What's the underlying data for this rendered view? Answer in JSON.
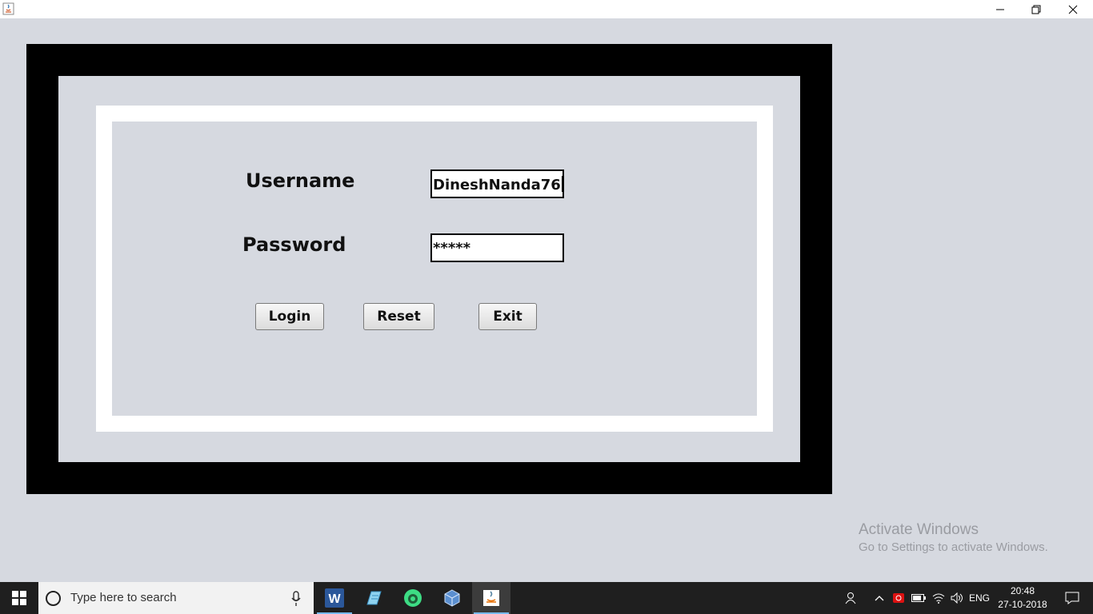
{
  "window": {
    "minimize_icon": "minimize-icon",
    "maximize_icon": "restore-icon",
    "close_icon": "close-icon"
  },
  "form": {
    "username_label": "Username",
    "username_value": "DineshNanda76",
    "password_label": "Password",
    "password_value": "*****",
    "login_label": "Login",
    "reset_label": "Reset",
    "exit_label": "Exit"
  },
  "watermark": {
    "title": "Activate Windows",
    "subtitle": "Go to Settings to activate Windows."
  },
  "taskbar": {
    "search_placeholder": "Type here to search",
    "apps": [
      "word-icon",
      "notes-icon",
      "android-studio-icon",
      "virtualbox-icon",
      "java-icon"
    ],
    "language": "ENG",
    "time": "20:48",
    "date": "27-10-2018"
  },
  "colors": {
    "frame": "#000000",
    "panel": "#d6d9e0",
    "taskbar": "#1f1f1f",
    "accent": "#76b9ed"
  }
}
